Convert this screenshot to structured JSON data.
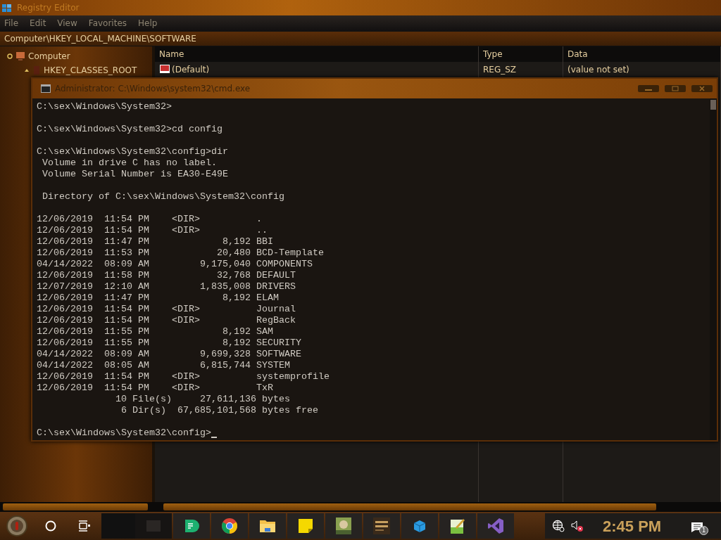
{
  "registry_window": {
    "title": "Registry Editor",
    "menu": [
      "File",
      "Edit",
      "View",
      "Favorites",
      "Help"
    ],
    "address": "Computer\\HKEY_LOCAL_MACHINE\\SOFTWARE",
    "tree": [
      {
        "label": "Computer",
        "expanded": true,
        "children": [
          {
            "label": "HKEY_CLASSES_ROOT",
            "expanded": false
          }
        ]
      }
    ],
    "columns": [
      "Name",
      "Type",
      "Data"
    ],
    "rows": [
      {
        "name": "(Default)",
        "type": "REG_SZ",
        "data": "(value not set)"
      }
    ]
  },
  "console_window": {
    "title": "Administrator: C:\\Windows\\system32\\cmd.exe",
    "blocks": [
      [
        "C:\\sex\\Windows\\System32>"
      ],
      [
        "C:\\sex\\Windows\\System32>cd config"
      ],
      [
        "C:\\sex\\Windows\\System32\\config>dir",
        " Volume in drive C has no label.",
        " Volume Serial Number is EA30-E49E"
      ],
      [
        " Directory of C:\\sex\\Windows\\System32\\config"
      ],
      [
        "12/06/2019  11:54 PM    <DIR>          .",
        "12/06/2019  11:54 PM    <DIR>          ..",
        "12/06/2019  11:47 PM             8,192 BBI",
        "12/06/2019  11:53 PM            20,480 BCD-Template",
        "04/14/2022  08:09 AM         9,175,040 COMPONENTS",
        "12/06/2019  11:58 PM            32,768 DEFAULT",
        "12/07/2019  12:10 AM         1,835,008 DRIVERS",
        "12/06/2019  11:47 PM             8,192 ELAM",
        "12/06/2019  11:54 PM    <DIR>          Journal",
        "12/06/2019  11:54 PM    <DIR>          RegBack",
        "12/06/2019  11:55 PM             8,192 SAM",
        "12/06/2019  11:55 PM             8,192 SECURITY",
        "04/14/2022  08:09 AM         9,699,328 SOFTWARE",
        "04/14/2022  08:05 AM         6,815,744 SYSTEM",
        "12/06/2019  11:54 PM    <DIR>          systemprofile",
        "12/06/2019  11:54 PM    <DIR>          TxR",
        "              10 File(s)     27,611,136 bytes",
        "               6 Dir(s)  67,685,101,568 bytes free"
      ],
      [
        "C:\\sex\\Windows\\System32\\config>"
      ]
    ]
  },
  "taskbar": {
    "clock": "2:45 PM",
    "notification_count": "1"
  }
}
